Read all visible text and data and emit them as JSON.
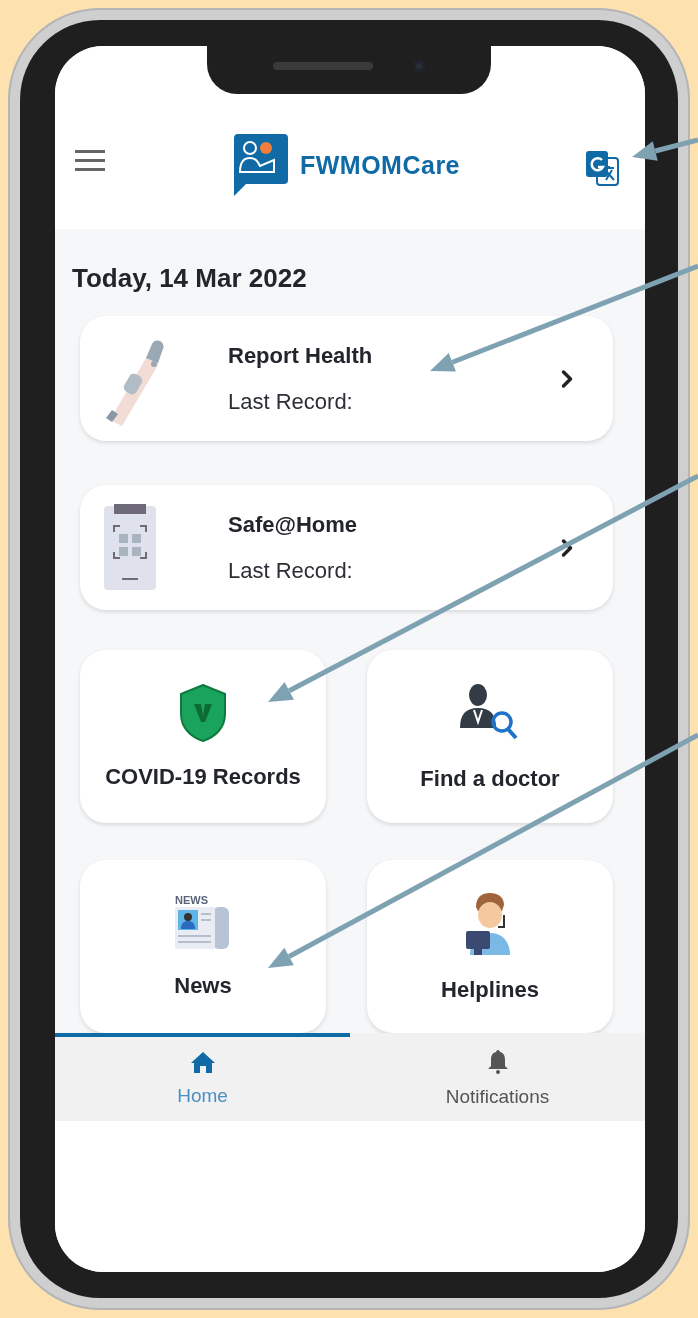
{
  "app": {
    "title": "FWMOMCare"
  },
  "date": "Today, 14 Mar 2022",
  "records": [
    {
      "title": "Report Health",
      "subtitle": "Last Record:",
      "kind": "thermometer"
    },
    {
      "title": "Safe@Home",
      "subtitle": "Last Record:",
      "kind": "scanner"
    }
  ],
  "tiles": [
    {
      "label": "COVID-19 Records",
      "kind": "shield"
    },
    {
      "label": "Find a doctor",
      "kind": "doctor"
    },
    {
      "label": "News",
      "kind": "news",
      "icon_text": "NEWS"
    },
    {
      "label": "Helplines",
      "kind": "helpline"
    }
  ],
  "nav": [
    {
      "label": "Home",
      "kind": "home",
      "selected": true
    },
    {
      "label": "Notifications",
      "kind": "bell",
      "selected": false
    }
  ]
}
